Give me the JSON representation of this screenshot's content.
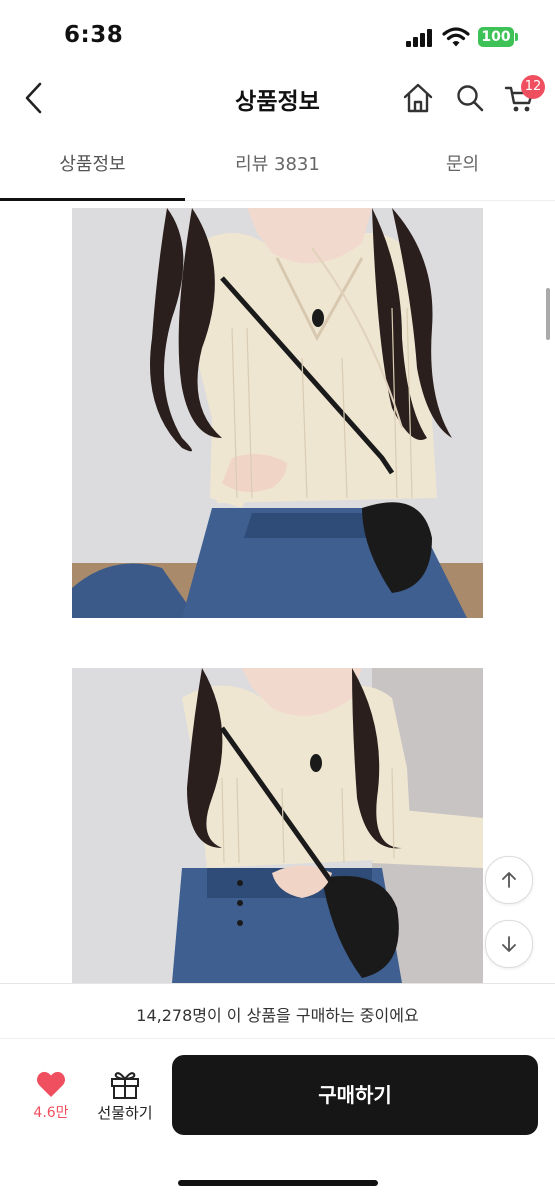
{
  "status_bar": {
    "time": "6:38",
    "battery": "100"
  },
  "header": {
    "title": "상품정보",
    "cart_count": "12"
  },
  "tabs": [
    {
      "label": "상품정보",
      "active": true
    },
    {
      "label": "리뷰 3831",
      "active": false
    },
    {
      "label": "문의",
      "active": false
    }
  ],
  "images": [
    {
      "alt": "product photo 1"
    },
    {
      "alt": "product photo 2"
    }
  ],
  "notice": "14,278명이 이 상품을 구매하는 중이에요",
  "bottom_bar": {
    "like_count": "4.6만",
    "gift_label": "선물하기",
    "buy_label": "구매하기"
  },
  "colors": {
    "accent": "#ef4f5f",
    "battery": "#3ec257",
    "buy_button": "#161616"
  }
}
